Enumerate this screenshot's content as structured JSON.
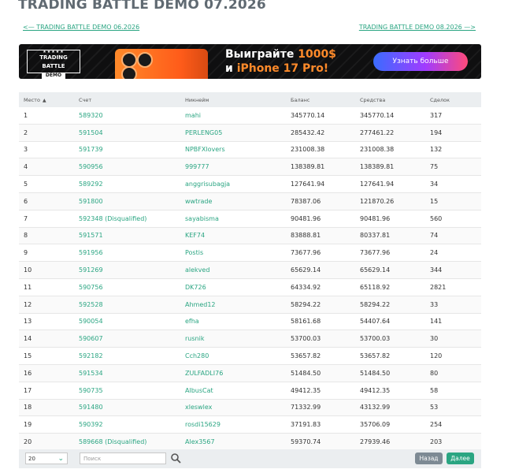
{
  "page": {
    "title": "TRADING BATTLE DEMO 07.2026",
    "prev_link": "<— TRADING BATTLE DEMO 06.2026",
    "next_link": "TRADING BATTLE DEMO 08.2026 —>"
  },
  "banner": {
    "badge_title": "TRADING BATTLE",
    "badge_sub": "DEMO",
    "promo_line1": "Выиграйте ",
    "promo_amount": "1000$",
    "promo_line2_prefix": "и ",
    "promo_product": "iPhone 17 Pro!",
    "cta": "Узнать больше"
  },
  "table": {
    "headers": [
      "Место",
      "Счет",
      "Никнейм",
      "Баланс",
      "Средства",
      "Сделок"
    ],
    "sorted_column": "Место",
    "rows": [
      [
        "1",
        "589320",
        "mahi",
        "345770.14",
        "345770.14",
        "317"
      ],
      [
        "2",
        "591504",
        "PERLENG05",
        "285432.42",
        "277461.22",
        "194"
      ],
      [
        "3",
        "591739",
        "NPBFXlovers",
        "231008.38",
        "231008.38",
        "132"
      ],
      [
        "4",
        "590956",
        "999777",
        "138389.81",
        "138389.81",
        "75"
      ],
      [
        "5",
        "589292",
        "anggrisubagja",
        "127641.94",
        "127641.94",
        "34"
      ],
      [
        "6",
        "591800",
        "wwtrade",
        "78387.06",
        "121870.26",
        "15"
      ],
      [
        "7",
        "592348 (Disqualified)",
        "sayabisma",
        "90481.96",
        "90481.96",
        "560"
      ],
      [
        "8",
        "591571",
        "KEF74",
        "83888.81",
        "80337.81",
        "74"
      ],
      [
        "9",
        "591956",
        "Postis",
        "73677.96",
        "73677.96",
        "24"
      ],
      [
        "10",
        "591269",
        "alekved",
        "65629.14",
        "65629.14",
        "344"
      ],
      [
        "11",
        "590756",
        "DK726",
        "64334.92",
        "65118.92",
        "2821"
      ],
      [
        "12",
        "592528",
        "Ahmed12",
        "58294.22",
        "58294.22",
        "33"
      ],
      [
        "13",
        "590054",
        "efha",
        "58161.68",
        "54407.64",
        "141"
      ],
      [
        "14",
        "590607",
        "rusnik",
        "53700.03",
        "53700.03",
        "30"
      ],
      [
        "15",
        "592182",
        "Cch280",
        "53657.82",
        "53657.82",
        "120"
      ],
      [
        "16",
        "591534",
        "ZULFADLI76",
        "51484.50",
        "51484.50",
        "80"
      ],
      [
        "17",
        "590735",
        "AlbusCat",
        "49412.35",
        "49412.35",
        "58"
      ],
      [
        "18",
        "591480",
        "xleswlex",
        "71332.99",
        "43132.99",
        "53"
      ],
      [
        "19",
        "590392",
        "rosdi15629",
        "37191.83",
        "35706.09",
        "254"
      ],
      [
        "20",
        "589668 (Disqualified)",
        "Alex3567",
        "59370.74",
        "27939.46",
        "203"
      ]
    ]
  },
  "footer": {
    "page_size": "20",
    "search_placeholder": "Поиск",
    "prev_label": "Назад",
    "next_label": "Далее"
  },
  "colors": {
    "accent": "#2aa582",
    "header_bg": "#ebeef0",
    "prev_button": "#7d8a94"
  },
  "icons": {
    "sort": "sort-ascending-icon",
    "search": "search-icon",
    "dropdown": "chevron-down-icon"
  }
}
